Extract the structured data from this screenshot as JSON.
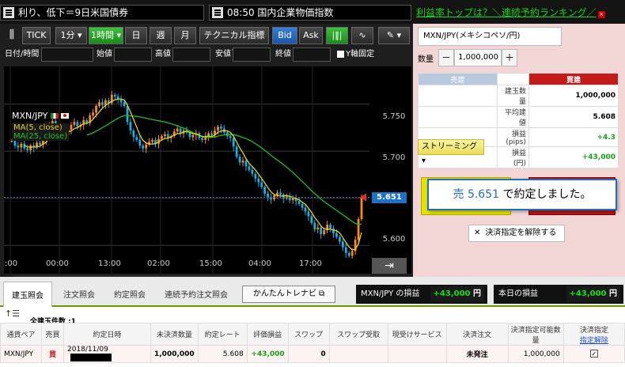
{
  "ticker": {
    "item1": "利り、低下＝9日米国債券",
    "item2": "08:50 国内企業物価指数",
    "promo": "利益率トップは？＼連続予約ランキング／"
  },
  "toolbar": {
    "tick": "TICK",
    "period1": "1分",
    "period2": "1時間",
    "day": "日",
    "week": "週",
    "month": "月",
    "indicator": "テクニカル指標",
    "bid": "Bid",
    "ask": "Ask"
  },
  "ohlc": {
    "datetime_label": "日付/時間",
    "open_label": "始値",
    "high_label": "高値",
    "low_label": "安値",
    "close_label": "終値",
    "yfix_label": "Y軸固定"
  },
  "chart": {
    "symbol": "MXN/JPY",
    "ma5_label": "MA(5, close)",
    "ma25_label": "MA(25, close)",
    "current_price": "5.651",
    "colors": {
      "up": "#ff8c1a",
      "down": "#1ab0e6",
      "ma5": "#e6d21e",
      "ma25": "#1fbf1f",
      "price": "#1a73c8"
    }
  },
  "chart_data": {
    "type": "candlestick",
    "symbol": "MXN/JPY",
    "timeframe": "1時間",
    "yticks": [
      "5.750",
      "5.700",
      "5.650",
      "5.600"
    ],
    "xticks": [
      ":00",
      "00:00",
      "13:00",
      "02:00",
      "15:00",
      "04:00",
      "17:00"
    ],
    "ylim": [
      5.57,
      5.79
    ],
    "last": 5.651,
    "ma5_label": "MA(5, close)",
    "ma25_label": "MA(25, close)",
    "closes": [
      5.711,
      5.706,
      5.704,
      5.708,
      5.703,
      5.701,
      5.706,
      5.704,
      5.709,
      5.707,
      5.712,
      5.715,
      5.729,
      5.732,
      5.724,
      5.719,
      5.721,
      5.717,
      5.723,
      5.728,
      5.731,
      5.726,
      5.728,
      5.733,
      5.73,
      5.738,
      5.741,
      5.748,
      5.752,
      5.749,
      5.754,
      5.751,
      5.76,
      5.758,
      5.755,
      5.752,
      5.748,
      5.731,
      5.722,
      5.715,
      5.712,
      5.706,
      5.703,
      5.707,
      5.71,
      5.712,
      5.708,
      5.713,
      5.716,
      5.718,
      5.714,
      5.716,
      5.721,
      5.724,
      5.719,
      5.722,
      5.72,
      5.715,
      5.717,
      5.719,
      5.714,
      5.712,
      5.716,
      5.719,
      5.717,
      5.722,
      5.726,
      5.724,
      5.72,
      5.716,
      5.714,
      5.705,
      5.694,
      5.688,
      5.69,
      5.684,
      5.68,
      5.676,
      5.671,
      5.667,
      5.662,
      5.655,
      5.651,
      5.649,
      5.653,
      5.656,
      5.654,
      5.65,
      5.652,
      5.648,
      5.651,
      5.647,
      5.644,
      5.64,
      5.636,
      5.631,
      5.624,
      5.617,
      5.619,
      5.612,
      5.616,
      5.622,
      5.618,
      5.613,
      5.609,
      5.604,
      5.598,
      5.592,
      5.589,
      5.594,
      5.606,
      5.628,
      5.651
    ]
  },
  "order": {
    "symbol_box": "MXN/JPY(メキシコペソ/円)",
    "qty_label": "数量",
    "qty": "1,000,000",
    "minus": "－",
    "plus": "＋",
    "sell_header": "売建",
    "buy_header": "買建",
    "rows": [
      {
        "k": "建玉数量",
        "v": "1,000,000"
      },
      {
        "k": "平均建値",
        "v": "5.608"
      },
      {
        "k": "損益(pips)",
        "v": "+4.3"
      },
      {
        "k": "損益(円)",
        "v": "+43,000"
      }
    ],
    "streaming": "ストリーミング",
    "confirm_prefix": "売 5.651",
    "confirm_suffix": " で約定しました。",
    "unlock": "決済指定を解除する"
  },
  "bottom": {
    "tabs": [
      "建玉照会",
      "注文照会",
      "約定照会",
      "連続予約注文照会"
    ],
    "easy_btn": "かんたんトレナビ",
    "pnl1_label": "MXN/JPY の損益",
    "pnl1_value": "+43,000",
    "pnl2_label": "本日の損益",
    "pnl2_value": "+43,000",
    "unit": "円",
    "count": "全建玉件数 :1",
    "headers": [
      "通貨ペア",
      "売買",
      "約定日時",
      "未決済数量",
      "約定レート",
      "評価損益",
      "スワップ",
      "スワップ受取",
      "現受けサービス",
      "決済注文",
      "決済指定可能数量",
      "決済指定"
    ],
    "header_link": "指定解除",
    "row": {
      "pair": "MXN/JPY",
      "side": "買",
      "date": "2018/11/09",
      "qty": "1,000,000",
      "rate": "5.608",
      "pnl": "+43,000",
      "swap": "0",
      "order": "未発注",
      "avail": "1,000,000"
    }
  }
}
